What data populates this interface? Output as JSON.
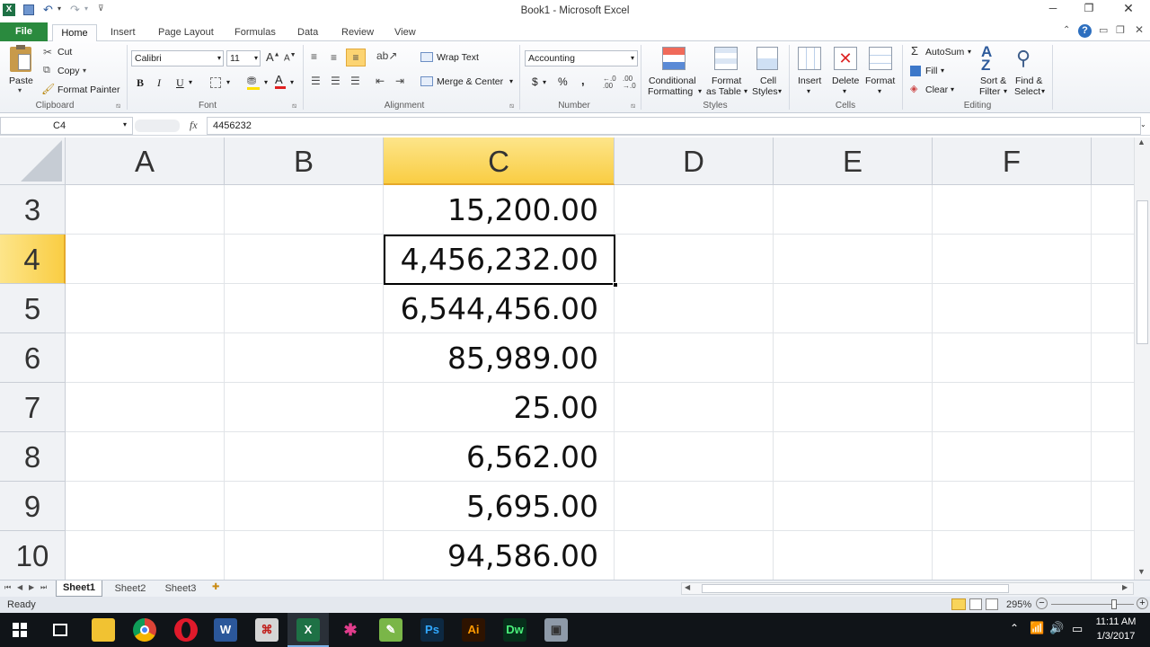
{
  "window": {
    "title": "Book1  -  Microsoft Excel"
  },
  "tabs": [
    "File",
    "Home",
    "Insert",
    "Page Layout",
    "Formulas",
    "Data",
    "Review",
    "View"
  ],
  "ribbon": {
    "clipboard": {
      "paste": "Paste",
      "cut": "Cut",
      "copy": "Copy",
      "format_painter": "Format Painter",
      "label": "Clipboard"
    },
    "font": {
      "name": "Calibri",
      "size": "11",
      "label": "Font",
      "bold": "B",
      "italic": "I",
      "underline": "U"
    },
    "alignment": {
      "wrap": "Wrap Text",
      "merge": "Merge & Center",
      "label": "Alignment"
    },
    "number": {
      "format": "Accounting",
      "currency": "$",
      "percent": "%",
      "comma": ",",
      "label": "Number"
    },
    "styles": {
      "conditional": "Conditional",
      "conditional2": "Formatting",
      "format_table": "Format",
      "format_table2": "as Table",
      "cell_styles": "Cell",
      "cell_styles2": "Styles",
      "label": "Styles"
    },
    "cells": {
      "insert": "Insert",
      "delete": "Delete",
      "format": "Format",
      "label": "Cells"
    },
    "editing": {
      "autosum": "AutoSum",
      "fill": "Fill",
      "clear": "Clear",
      "sort": "Sort &",
      "sort2": "Filter",
      "find": "Find &",
      "find2": "Select",
      "label": "Editing"
    }
  },
  "formula_bar": {
    "name_box": "C4",
    "fx": "fx",
    "formula": "4456232"
  },
  "grid": {
    "columns": [
      "A",
      "B",
      "C",
      "D",
      "E",
      "F"
    ],
    "selected_column": "C",
    "selected_row": "4",
    "rows": [
      {
        "row": "3",
        "c": "15,200.00"
      },
      {
        "row": "4",
        "c": "4,456,232.00"
      },
      {
        "row": "5",
        "c": "6,544,456.00"
      },
      {
        "row": "6",
        "c": "85,989.00"
      },
      {
        "row": "7",
        "c": "25.00"
      },
      {
        "row": "8",
        "c": "6,562.00"
      },
      {
        "row": "9",
        "c": "5,695.00"
      },
      {
        "row": "10",
        "c": "94,586.00"
      }
    ]
  },
  "sheets": [
    "Sheet1",
    "Sheet2",
    "Sheet3"
  ],
  "status": {
    "ready": "Ready",
    "zoom": "295%"
  },
  "taskbar": {
    "time": "11:11 AM",
    "date": "1/3/2017",
    "apps": [
      "W",
      "Ps",
      "Ai",
      "Dw"
    ]
  },
  "colors": {
    "accent": "#2a6e2a",
    "selected_header": "#fcd84e",
    "selection_border": "#000000"
  }
}
